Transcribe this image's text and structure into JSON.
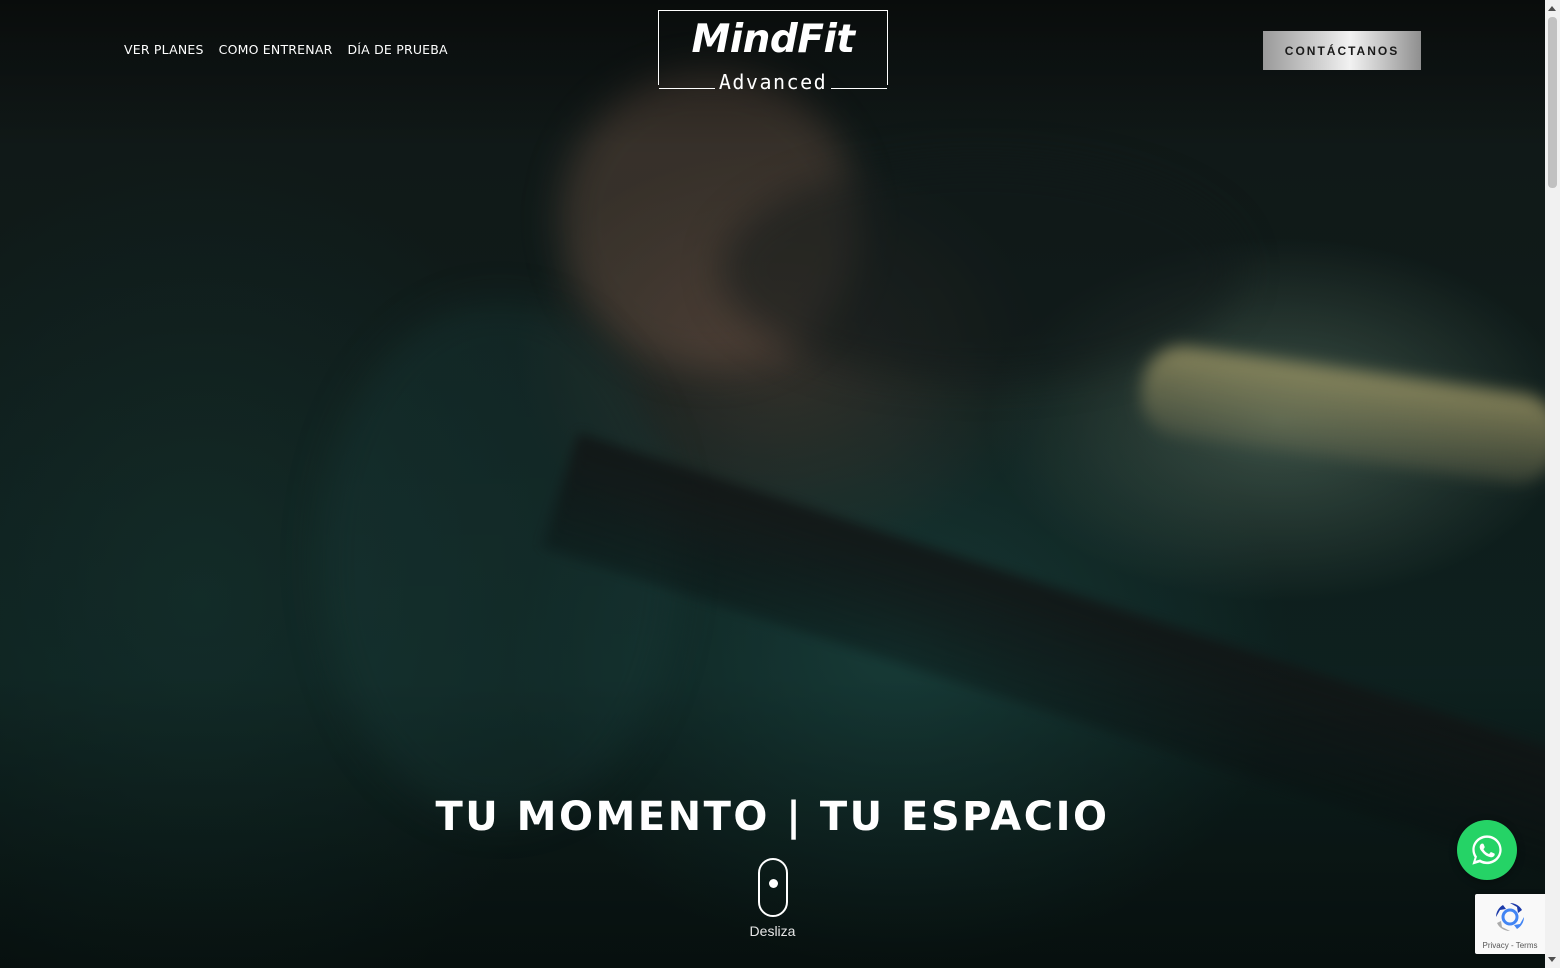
{
  "nav": {
    "items": [
      "VER PLANES",
      "COMO ENTRENAR",
      "DÍA DE PRUEBA"
    ]
  },
  "logo": {
    "brand": "MindFit",
    "sub": "Advanced"
  },
  "cta": {
    "label": "CONTÁCTANOS"
  },
  "hero": {
    "headline": "TU MOMENTO | TU ESPACIO",
    "scroll_label": "Desliza"
  },
  "recaptcha": {
    "links": "Privacy - Terms"
  },
  "colors": {
    "whatsapp": "#25d366",
    "text": "#ffffff",
    "background": "#0f2422"
  },
  "icons": {
    "whatsapp": "whatsapp-icon",
    "recaptcha": "recaptcha-icon",
    "scroll": "mouse-scroll-icon"
  }
}
